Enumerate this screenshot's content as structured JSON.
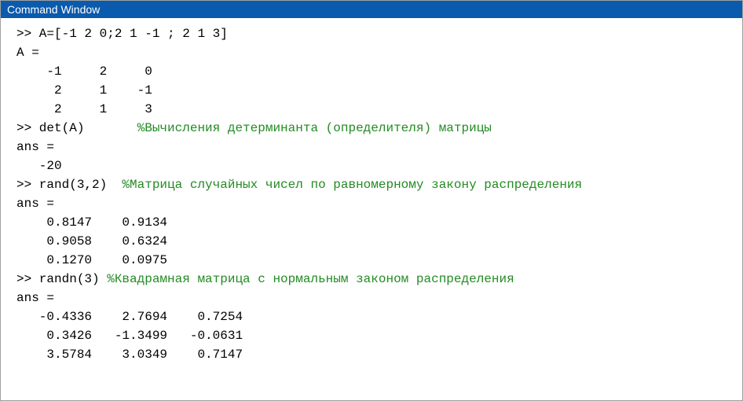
{
  "title": "Command Window",
  "lines": [
    {
      "text": ">> A=[-1 2 0;2 1 -1 ; 2 1 3]"
    },
    {
      "text": "A ="
    },
    {
      "text": "    -1     2     0"
    },
    {
      "text": "     2     1    -1"
    },
    {
      "text": "     2     1     3"
    },
    {
      "text": ">> det(A)       ",
      "comment": "%Вычисления детерминанта (определителя) матрицы"
    },
    {
      "text": "ans ="
    },
    {
      "text": "   -20"
    },
    {
      "text": ">> rand(3,2)  ",
      "comment": "%Матрица случайных чисел по равномерному закону распределения"
    },
    {
      "text": "ans ="
    },
    {
      "text": "    0.8147    0.9134"
    },
    {
      "text": "    0.9058    0.6324"
    },
    {
      "text": "    0.1270    0.0975"
    },
    {
      "text": ">> randn(3) ",
      "comment": "%Квадрамная матрица с нормальным законом распределения"
    },
    {
      "text": "ans ="
    },
    {
      "text": "   -0.4336    2.7694    0.7254"
    },
    {
      "text": "    0.3426   -1.3499   -0.0631"
    },
    {
      "text": "    3.5784    3.0349    0.7147"
    }
  ]
}
